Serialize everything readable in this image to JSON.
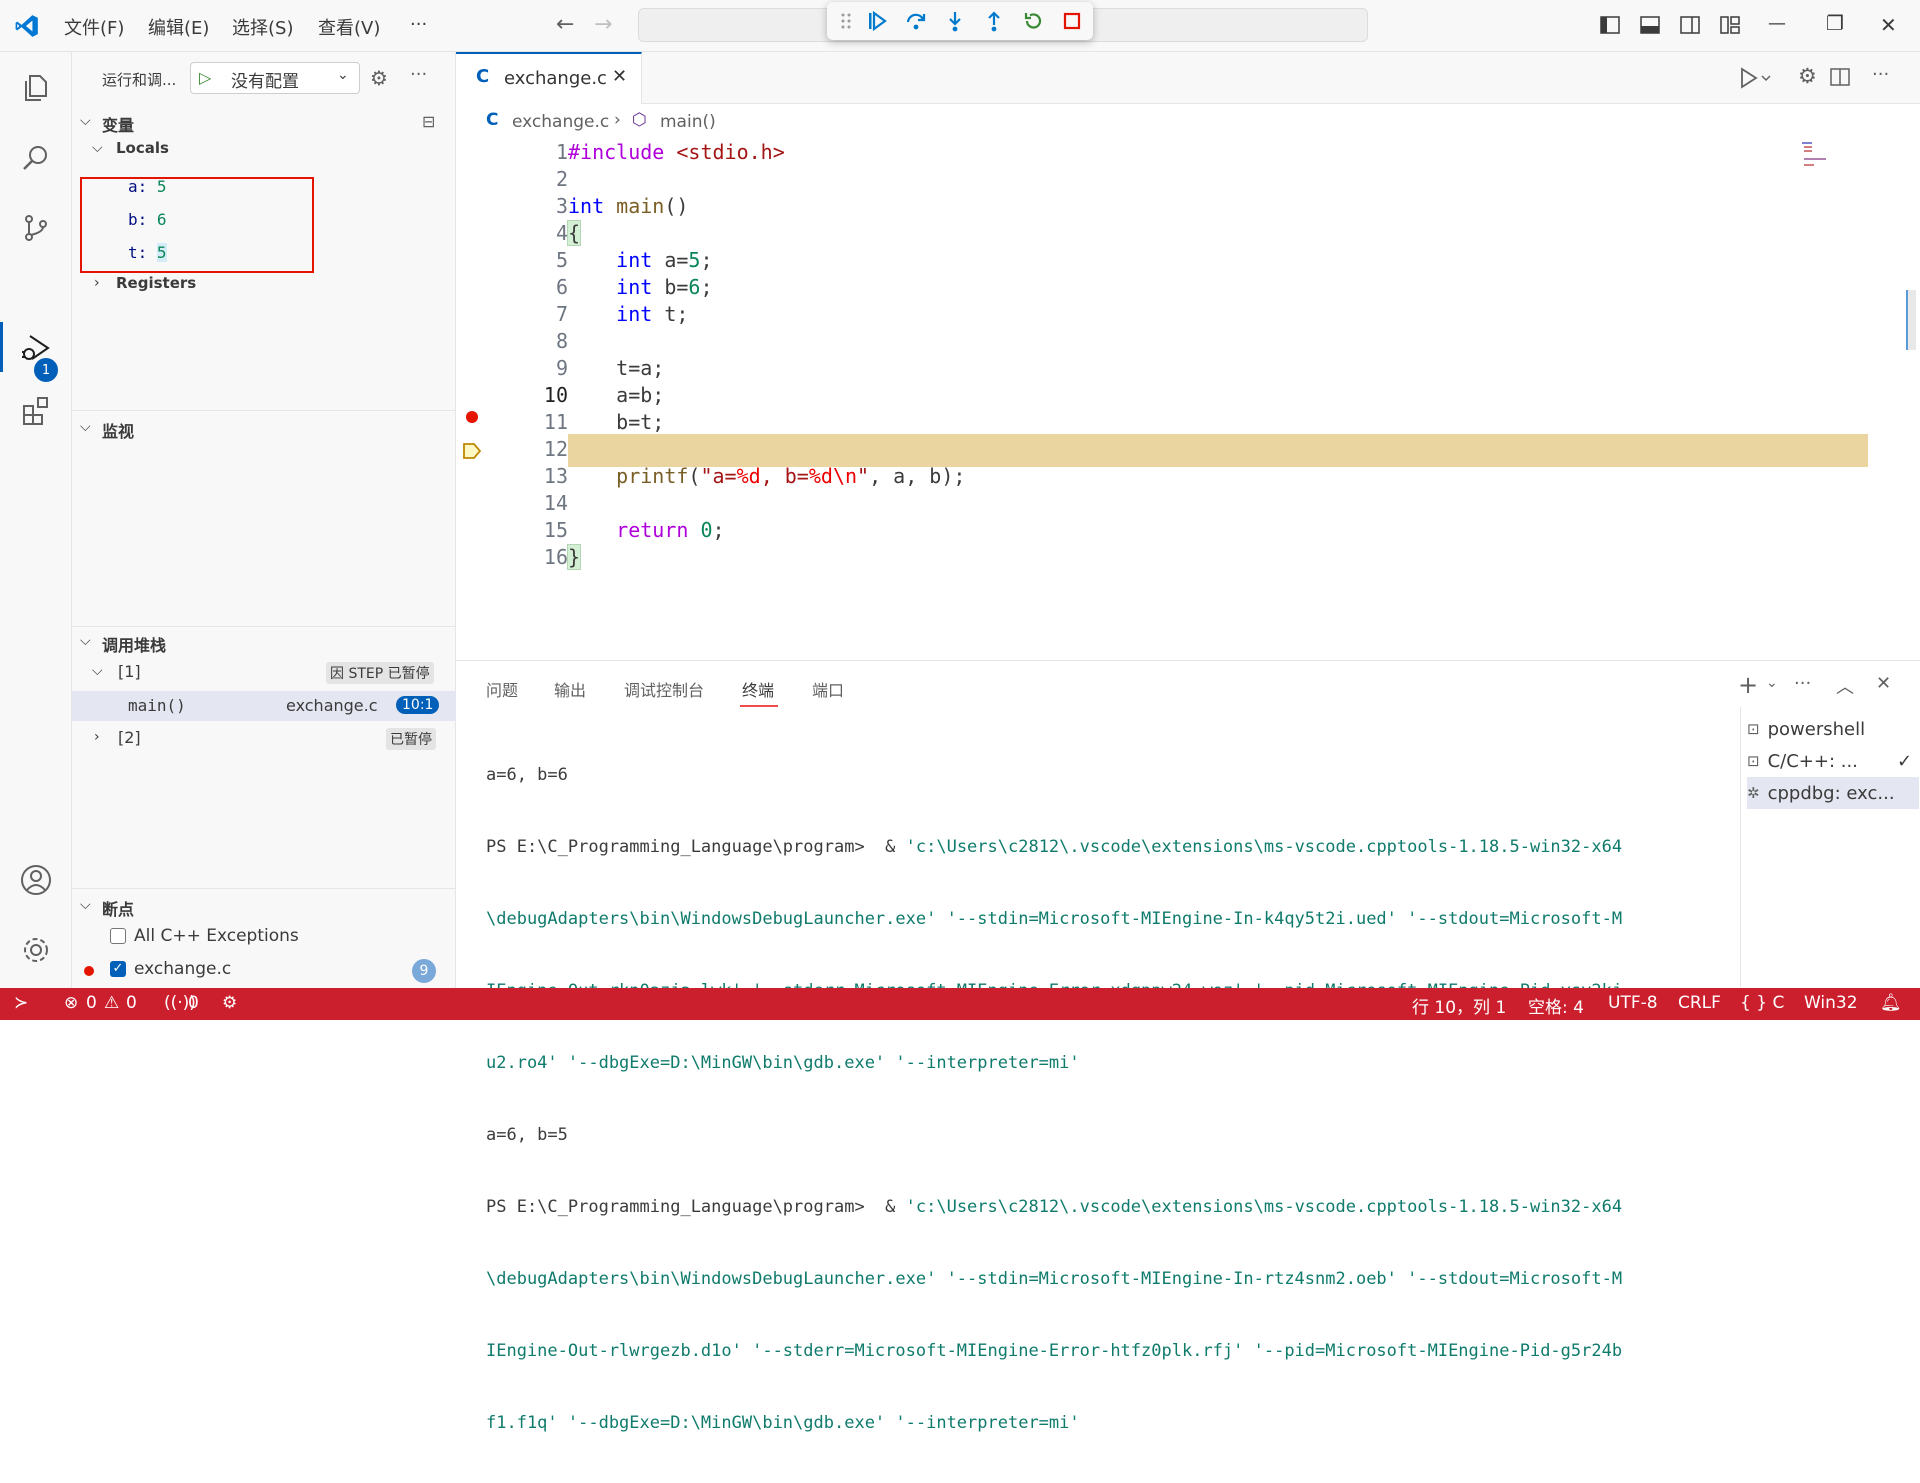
{
  "titlebar": {
    "menus": [
      "文件(F)",
      "编辑(E)",
      "选择(S)",
      "查看(V)",
      "···"
    ]
  },
  "debug_toolbar": {
    "items": [
      "grip",
      "continue",
      "step-over",
      "step-into",
      "step-out",
      "restart",
      "stop"
    ]
  },
  "sidebar": {
    "run_label": "运行和调...",
    "config_label": "没有配置",
    "variables_title": "变量",
    "locals_title": "Locals",
    "locals": [
      {
        "name": "a",
        "value": "5"
      },
      {
        "name": "b",
        "value": "6"
      },
      {
        "name": "t",
        "value": "5"
      }
    ],
    "registers_title": "Registers",
    "watch_title": "监视",
    "callstack_title": "调用堆栈",
    "thread1": "[1]",
    "thread1_status": "因 STEP 已暂停",
    "frame_name": "main()",
    "frame_file": "exchange.c",
    "frame_pos": "10:1",
    "thread2": "[2]",
    "thread2_status": "已暂停",
    "breakpoints_title": "断点",
    "bp_exceptions": "All C++ Exceptions",
    "bp_file": "exchange.c",
    "bp_count": "9"
  },
  "editor": {
    "tab_name": "exchange.c",
    "breadcrumb_file": "exchange.c",
    "breadcrumb_symbol": "main()",
    "line_numbers": [
      "1",
      "2",
      "3",
      "4",
      "5",
      "6",
      "7",
      "8",
      "9",
      "10",
      "11",
      "12",
      "13",
      "14",
      "15",
      "16"
    ],
    "current_line": "10",
    "breakpoint_line": "9"
  },
  "panel": {
    "tabs": [
      "问题",
      "输出",
      "调试控制台",
      "终端",
      "端口"
    ],
    "active_tab": "终端",
    "terminal_lines": [
      "a=6, b=6",
      "PS E:\\C_Programming_Language\\program>  & ",
      "'c:\\Users\\c2812\\.vscode\\extensions\\ms-vscode.cpptools-1.18.5-win32-x64",
      "\\debugAdapters\\bin\\WindowsDebugLauncher.exe' '--stdin=Microsoft-MIEngine-In-k4qy5t2i.ued' '--stdout=Microsoft-M",
      "IEngine-Out-rkn0azja.lwk' '--stderr=Microsoft-MIEngine-Error-xdqppw24.woz' '--pid=Microsoft-MIEngine-Pid-ysy2kj",
      "u2.ro4' '--dbgExe=D:\\MinGW\\bin\\gdb.exe' '--interpreter=mi'",
      "a=6, b=5",
      "PS E:\\C_Programming_Language\\program>  & ",
      "'c:\\Users\\c2812\\.vscode\\extensions\\ms-vscode.cpptools-1.18.5-win32-x64",
      "\\debugAdapters\\bin\\WindowsDebugLauncher.exe' '--stdin=Microsoft-MIEngine-In-rtz4snm2.oeb' '--stdout=Microsoft-M",
      "IEngine-Out-rlwrgezb.d1o' '--stderr=Microsoft-MIEngine-Error-htfz0plk.rfj' '--pid=Microsoft-MIEngine-Pid-g5r24b",
      "f1.f1q' '--dbgExe=D:\\MinGW\\bin\\gdb.exe' '--interpreter=mi'"
    ],
    "terminals": [
      "powershell",
      "C/C++: ...",
      "cppdbg: exc..."
    ]
  },
  "statusbar": {
    "errors": "0",
    "warnings": "0",
    "ports": "0",
    "position": "行 10，列 1",
    "spaces": "空格: 4",
    "encoding": "UTF-8",
    "eol": "CRLF",
    "language": "{ } C",
    "platform": "Win32"
  },
  "colors": {
    "accent": "#005fb8",
    "statusbar": "#cc1f2e",
    "current_line": "#ead4a0",
    "breakpoint": "#e51400"
  }
}
